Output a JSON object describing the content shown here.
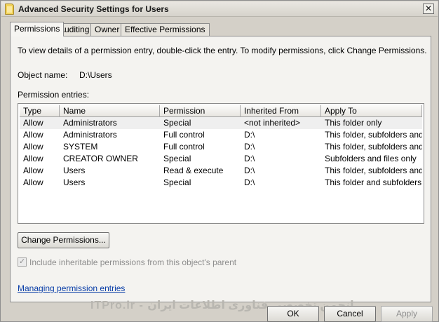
{
  "window": {
    "title": "Advanced Security Settings for Users"
  },
  "tabs": [
    {
      "label": "Permissions",
      "active": true
    },
    {
      "label": "Auditing",
      "active": false
    },
    {
      "label": "Owner",
      "active": false
    },
    {
      "label": "Effective Permissions",
      "active": false
    }
  ],
  "description": "To view details of a permission entry, double-click the entry. To modify permissions, click Change Permissions.",
  "object": {
    "label": "Object name:",
    "value": "D:\\Users"
  },
  "entries_label": "Permission entries:",
  "table": {
    "columns": [
      "Type",
      "Name",
      "Permission",
      "Inherited From",
      "Apply To"
    ],
    "rows": [
      [
        "Allow",
        "Administrators",
        "Special",
        "<not inherited>",
        "This folder only"
      ],
      [
        "Allow",
        "Administrators",
        "Full control",
        "D:\\",
        "This folder, subfolders and..."
      ],
      [
        "Allow",
        "SYSTEM",
        "Full control",
        "D:\\",
        "This folder, subfolders and..."
      ],
      [
        "Allow",
        "CREATOR OWNER",
        "Special",
        "D:\\",
        "Subfolders and files only"
      ],
      [
        "Allow",
        "Users",
        "Read & execute",
        "D:\\",
        "This folder, subfolders and..."
      ],
      [
        "Allow",
        "Users",
        "Special",
        "D:\\",
        "This folder and subfolders"
      ]
    ]
  },
  "change_button": "Change Permissions...",
  "inherit_checkbox": {
    "label": "Include inheritable permissions from this object's parent",
    "checked": true,
    "disabled": true
  },
  "help_link": "Managing permission entries",
  "buttons": {
    "ok": "OK",
    "cancel": "Cancel",
    "apply": "Apply"
  },
  "watermark": "ITPro.ir - انجمن تخصصی فناوری اطلاعات ایران",
  "icons": {
    "title": "folder-icon",
    "close": "close-icon"
  }
}
